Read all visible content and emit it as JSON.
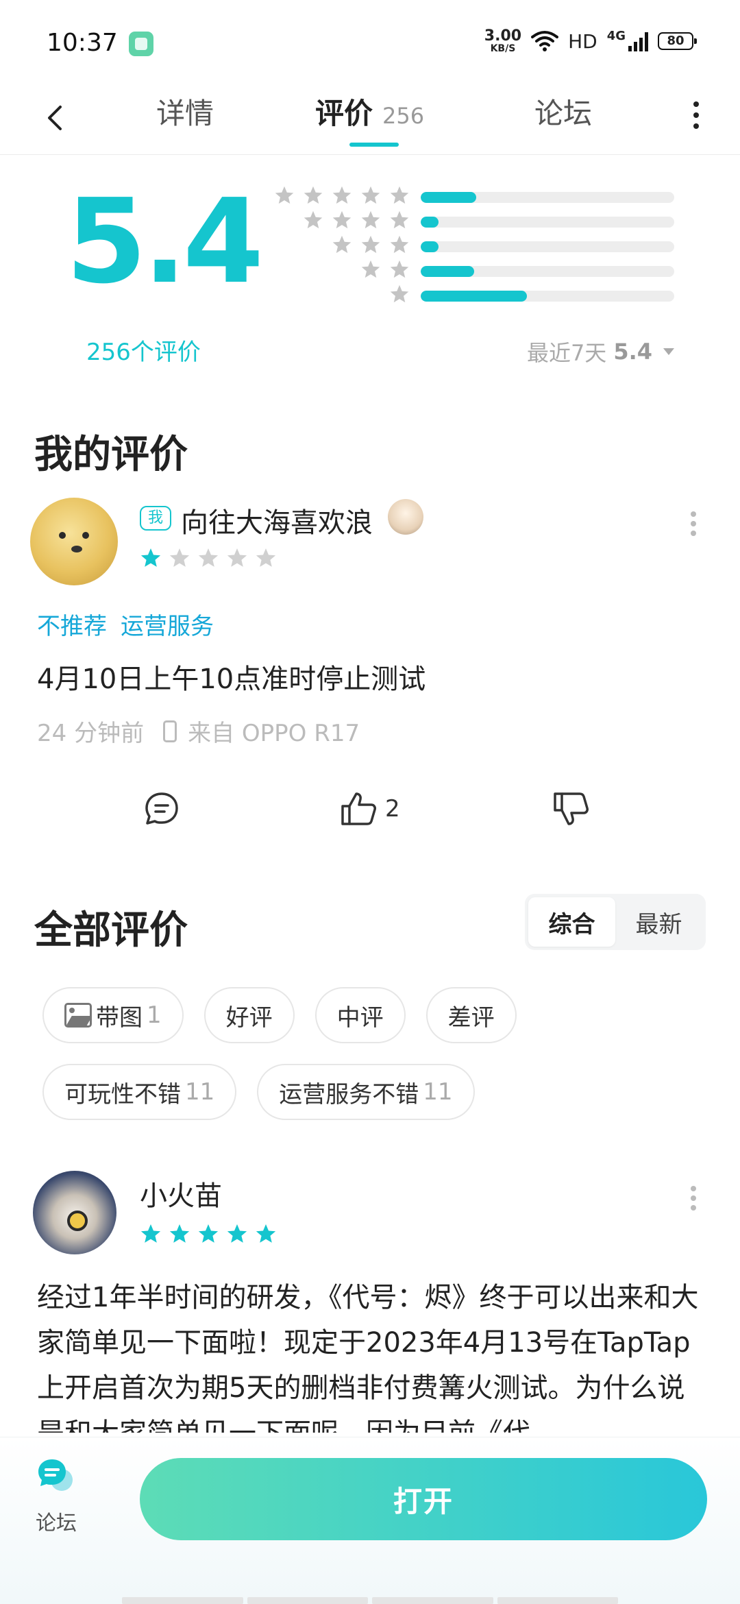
{
  "status_bar": {
    "time": "10:37",
    "net_speed_value": "3.00",
    "net_speed_unit": "KB/S",
    "hd": "HD",
    "network": "4G",
    "battery": "80"
  },
  "nav": {
    "tabs": [
      {
        "label": "详情"
      },
      {
        "label": "评价",
        "count": "256"
      },
      {
        "label": "论坛"
      }
    ],
    "active_tab": "评价"
  },
  "rating": {
    "score": "5.4",
    "count_label": "256个评价",
    "distribution": [
      {
        "stars": 5,
        "fraction": 0.22
      },
      {
        "stars": 4,
        "fraction": 0.07
      },
      {
        "stars": 3,
        "fraction": 0.07
      },
      {
        "stars": 2,
        "fraction": 0.21
      },
      {
        "stars": 1,
        "fraction": 0.42
      }
    ],
    "recent_label": "最近7天",
    "recent_score": "5.4"
  },
  "my_review": {
    "title": "我的评价",
    "badge": "我",
    "username": "向往大海喜欢浪",
    "stars": 1,
    "tags": [
      "不推荐",
      "运营服务"
    ],
    "text": "4月10日上午10点准时停止测试",
    "time": "24 分钟前",
    "device": "来自 OPPO R17",
    "like_count": "2"
  },
  "all_reviews": {
    "title": "全部评价",
    "sort_options": [
      "综合",
      "最新"
    ],
    "active_sort": "综合",
    "filters_row1": [
      {
        "label": "带图",
        "count": "1",
        "icon": "image-icon"
      },
      {
        "label": "好评",
        "count": ""
      },
      {
        "label": "中评",
        "count": ""
      },
      {
        "label": "差评",
        "count": ""
      }
    ],
    "filters_row2": [
      {
        "label": "可玩性不错",
        "count": "11"
      },
      {
        "label": "运营服务不错",
        "count": "11"
      }
    ]
  },
  "review": {
    "username": "小火苗",
    "stars": 5,
    "body": "经过1年半时间的研发，《代号：烬》终于可以出来和大家简单见一下面啦！现定于2023年4月13号在TapTap上开启首次为期5天的删档非付费篝火测试。为什么说是和大家简单见一下面呢，因为目前《代"
  },
  "bottom_bar": {
    "forum_label": "论坛",
    "open_label": "打开"
  },
  "colors": {
    "accent": "#15c5ce",
    "tag": "#15a7d8",
    "star_inactive": "#d0d0d0"
  }
}
